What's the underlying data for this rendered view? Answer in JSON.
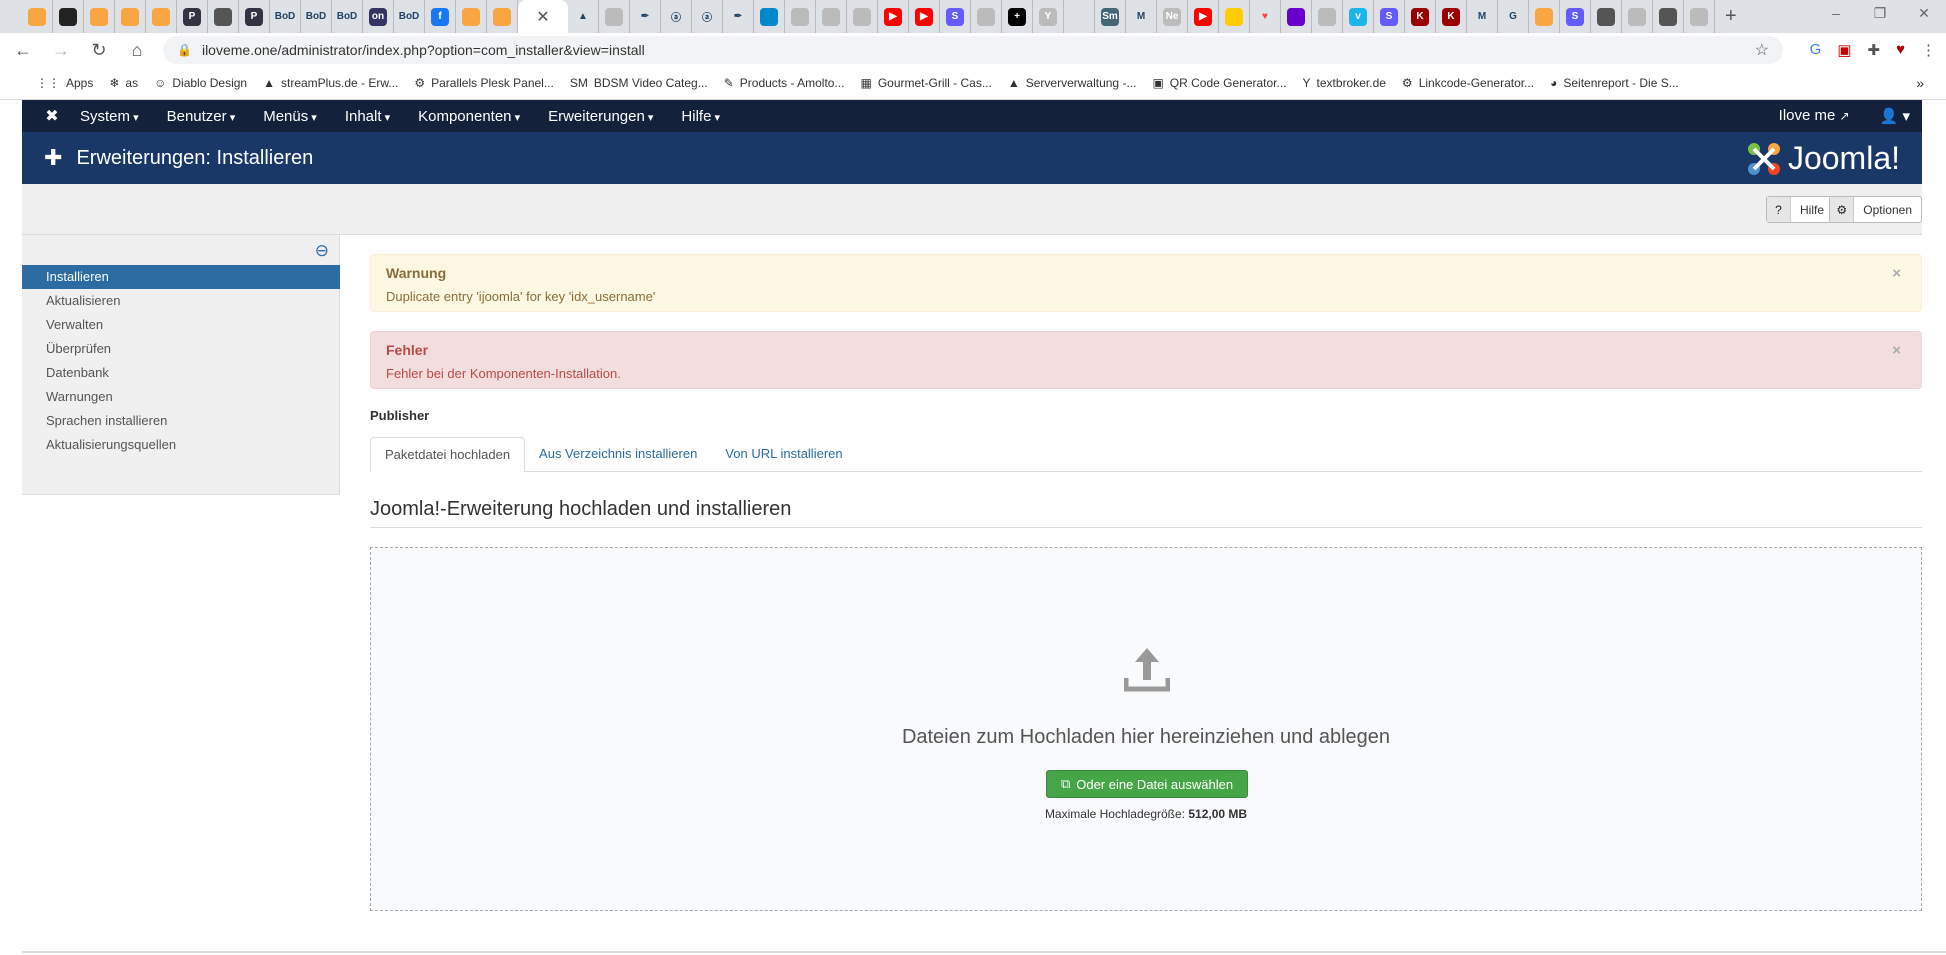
{
  "browser": {
    "tabs": [
      {
        "icon": "joomla-icon",
        "label": ""
      },
      {
        "icon": "joomla-dark-icon",
        "label": ""
      },
      {
        "icon": "joomla-icon",
        "label": ""
      },
      {
        "icon": "joomla-icon",
        "label": ""
      },
      {
        "icon": "joomla-icon",
        "label": ""
      },
      {
        "icon": "p-icon",
        "label": "P"
      },
      {
        "icon": "globe-icon",
        "label": ""
      },
      {
        "icon": "p-icon",
        "label": "P"
      },
      {
        "icon": "bod-icon",
        "label": "BoD"
      },
      {
        "icon": "bod-icon",
        "label": "BoD"
      },
      {
        "icon": "bod-icon",
        "label": "BoD"
      },
      {
        "icon": "on-icon",
        "label": "on"
      },
      {
        "icon": "bod-icon",
        "label": "BoD"
      },
      {
        "icon": "facebook-icon",
        "label": "f"
      },
      {
        "icon": "joomla-icon",
        "label": ""
      },
      {
        "icon": "joomla-icon",
        "label": ""
      }
    ],
    "active_tab_close": "✕",
    "tabs_after": [
      {
        "icon": "a-icon",
        "label": "▲"
      },
      {
        "icon": "circle-icon",
        "label": ""
      },
      {
        "icon": "pen-icon",
        "label": "✒"
      },
      {
        "icon": "swirl-icon",
        "label": "ⓐ"
      },
      {
        "icon": "swirl-icon",
        "label": "ⓐ"
      },
      {
        "icon": "pen-icon",
        "label": "✒"
      },
      {
        "icon": "blue-dot-icon",
        "label": ""
      },
      {
        "icon": "news-icon",
        "label": ""
      },
      {
        "icon": "generic-icon",
        "label": ""
      },
      {
        "icon": "circle-icon",
        "label": ""
      },
      {
        "icon": "youtube-icon",
        "label": "▶"
      },
      {
        "icon": "youtube-icon",
        "label": "▶"
      },
      {
        "icon": "s-icon",
        "label": "S"
      },
      {
        "icon": "person-icon",
        "label": ""
      },
      {
        "icon": "plus-icon",
        "label": "+"
      },
      {
        "icon": "textbroker-icon",
        "label": "Y"
      },
      {
        "icon": "swirl-icon",
        "label": ""
      },
      {
        "icon": "sm-icon",
        "label": "Sm"
      },
      {
        "icon": "gmail-icon",
        "label": "M"
      },
      {
        "icon": "ne-icon",
        "label": "Ne"
      },
      {
        "icon": "youtube-icon",
        "label": "▶"
      },
      {
        "icon": "mailchimp-icon",
        "label": ""
      },
      {
        "icon": "heart-icon",
        "label": "♥"
      },
      {
        "icon": "mail-icon",
        "label": ""
      },
      {
        "icon": "generic-icon",
        "label": ""
      },
      {
        "icon": "vimeo-icon",
        "label": "v"
      },
      {
        "icon": "s-icon",
        "label": "S"
      },
      {
        "icon": "k-icon",
        "label": "K"
      },
      {
        "icon": "k-icon",
        "label": "K"
      },
      {
        "icon": "gmail-icon",
        "label": "M"
      },
      {
        "icon": "google-icon",
        "label": "G"
      },
      {
        "icon": "joomla-icon",
        "label": ""
      },
      {
        "icon": "s-icon",
        "label": "S"
      },
      {
        "icon": "globe-icon",
        "label": ""
      },
      {
        "icon": "devil-icon",
        "label": ""
      },
      {
        "icon": "globe-icon",
        "label": ""
      },
      {
        "icon": "devil-icon",
        "label": ""
      }
    ],
    "new_tab": "+",
    "url": "iloveme.one/administrator/index.php?option=com_installer&view=install",
    "bookmarks": [
      {
        "icon": "apps-icon",
        "glyph": "⋮⋮",
        "label": "Apps"
      },
      {
        "icon": "snowflake-icon",
        "glyph": "❄",
        "label": "as"
      },
      {
        "icon": "devil-icon",
        "glyph": "☺",
        "label": "Diablo Design"
      },
      {
        "icon": "mountain-icon",
        "glyph": "▲",
        "label": "streamPlus.de - Erw..."
      },
      {
        "icon": "plesk-icon",
        "glyph": "⚙",
        "label": "Parallels Plesk Panel..."
      },
      {
        "icon": "sm-icon",
        "glyph": "SM",
        "label": "BDSM Video Categ..."
      },
      {
        "icon": "tool-icon",
        "glyph": "✎",
        "label": "Products - Amolto..."
      },
      {
        "icon": "calendar-icon",
        "glyph": "▦",
        "label": "Gourmet-Grill - Cas..."
      },
      {
        "icon": "mountain-icon",
        "glyph": "▲",
        "label": "Serververwaltung -..."
      },
      {
        "icon": "qr-icon",
        "glyph": "▣",
        "label": "QR Code Generator..."
      },
      {
        "icon": "textbroker-icon",
        "glyph": "Y",
        "label": "textbroker.de"
      },
      {
        "icon": "link-icon",
        "glyph": "⚙",
        "label": "Linkcode-Generator..."
      },
      {
        "icon": "pie-icon",
        "glyph": "◕",
        "label": "Seitenreport - Die S..."
      }
    ],
    "bookmarks_more": "»"
  },
  "nav": {
    "menu": [
      "System",
      "Benutzer",
      "Menüs",
      "Inhalt",
      "Komponenten",
      "Erweiterungen",
      "Hilfe"
    ],
    "site_link": "Ilove me",
    "user_menu": "▾"
  },
  "header": {
    "title": "Erweiterungen: Installieren",
    "logo_text": "Joomla!"
  },
  "toolbar": {
    "help": "Hilfe",
    "options": "Optionen"
  },
  "sidebar": {
    "items": [
      "Installieren",
      "Aktualisieren",
      "Verwalten",
      "Überprüfen",
      "Datenbank",
      "Warnungen",
      "Sprachen installieren",
      "Aktualisierungsquellen"
    ],
    "active_index": 0
  },
  "alerts": {
    "warning": {
      "title": "Warnung",
      "message": "Duplicate entry 'ijoomla' for key 'idx_username'"
    },
    "error": {
      "title": "Fehler",
      "message": "Fehler bei der Komponenten-Installation."
    },
    "close": "×"
  },
  "main": {
    "publisher": "Publisher",
    "tabs": [
      "Paketdatei hochladen",
      "Aus Verzeichnis installieren",
      "Von URL installieren"
    ],
    "section_title": "Joomla!-Erweiterung hochladen und installieren",
    "drop_text": "Dateien zum Hochladen hier hereinziehen und ablegen",
    "choose_button": "Oder eine Datei auswählen",
    "max_size_label": "Maximale Hochladegröße:",
    "max_size_value": "512,00 MB"
  },
  "colors": {
    "nav": "#14213a",
    "header": "#1a3867",
    "active": "#2d6ca2",
    "success": "#46a546"
  }
}
